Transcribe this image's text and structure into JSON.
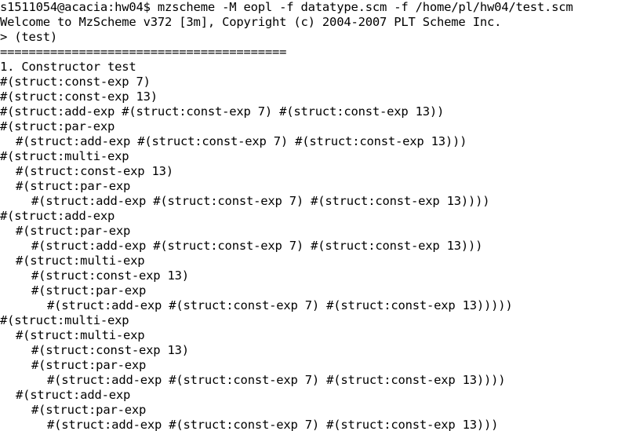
{
  "terminal": {
    "lines": [
      {
        "text": "s1511054@acacia:hw04$ mzscheme -M eopl -f datatype.scm -f /home/pl/hw04/test.scm",
        "indent": 0
      },
      {
        "text": "Welcome to MzScheme v372 [3m], Copyright (c) 2004-2007 PLT Scheme Inc.",
        "indent": 0
      },
      {
        "text": "> (test)",
        "indent": 0
      },
      {
        "text": "========================================",
        "indent": 0
      },
      {
        "text": "1. Constructor test",
        "indent": 0
      },
      {
        "text": "#(struct:const-exp 7)",
        "indent": 0
      },
      {
        "text": "#(struct:const-exp 13)",
        "indent": 0
      },
      {
        "text": "#(struct:add-exp #(struct:const-exp 7) #(struct:const-exp 13))",
        "indent": 0
      },
      {
        "text": "#(struct:par-exp",
        "indent": 0
      },
      {
        "text": "#(struct:add-exp #(struct:const-exp 7) #(struct:const-exp 13)))",
        "indent": 1
      },
      {
        "text": "#(struct:multi-exp",
        "indent": 0
      },
      {
        "text": "#(struct:const-exp 13)",
        "indent": 1
      },
      {
        "text": "#(struct:par-exp",
        "indent": 1
      },
      {
        "text": "#(struct:add-exp #(struct:const-exp 7) #(struct:const-exp 13))))",
        "indent": 2
      },
      {
        "text": "#(struct:add-exp",
        "indent": 0
      },
      {
        "text": "#(struct:par-exp",
        "indent": 1
      },
      {
        "text": "#(struct:add-exp #(struct:const-exp 7) #(struct:const-exp 13)))",
        "indent": 2
      },
      {
        "text": "#(struct:multi-exp",
        "indent": 1
      },
      {
        "text": "#(struct:const-exp 13)",
        "indent": 2
      },
      {
        "text": "#(struct:par-exp",
        "indent": 2
      },
      {
        "text": "#(struct:add-exp #(struct:const-exp 7) #(struct:const-exp 13)))))",
        "indent": 3
      },
      {
        "text": "#(struct:multi-exp",
        "indent": 0
      },
      {
        "text": "#(struct:multi-exp",
        "indent": 1
      },
      {
        "text": "#(struct:const-exp 13)",
        "indent": 2
      },
      {
        "text": "#(struct:par-exp",
        "indent": 2
      },
      {
        "text": "#(struct:add-exp #(struct:const-exp 7) #(struct:const-exp 13))))",
        "indent": 3
      },
      {
        "text": "#(struct:add-exp",
        "indent": 1
      },
      {
        "text": "#(struct:par-exp",
        "indent": 2
      },
      {
        "text": "#(struct:add-exp #(struct:const-exp 7) #(struct:const-exp 13)))",
        "indent": 3
      }
    ]
  }
}
